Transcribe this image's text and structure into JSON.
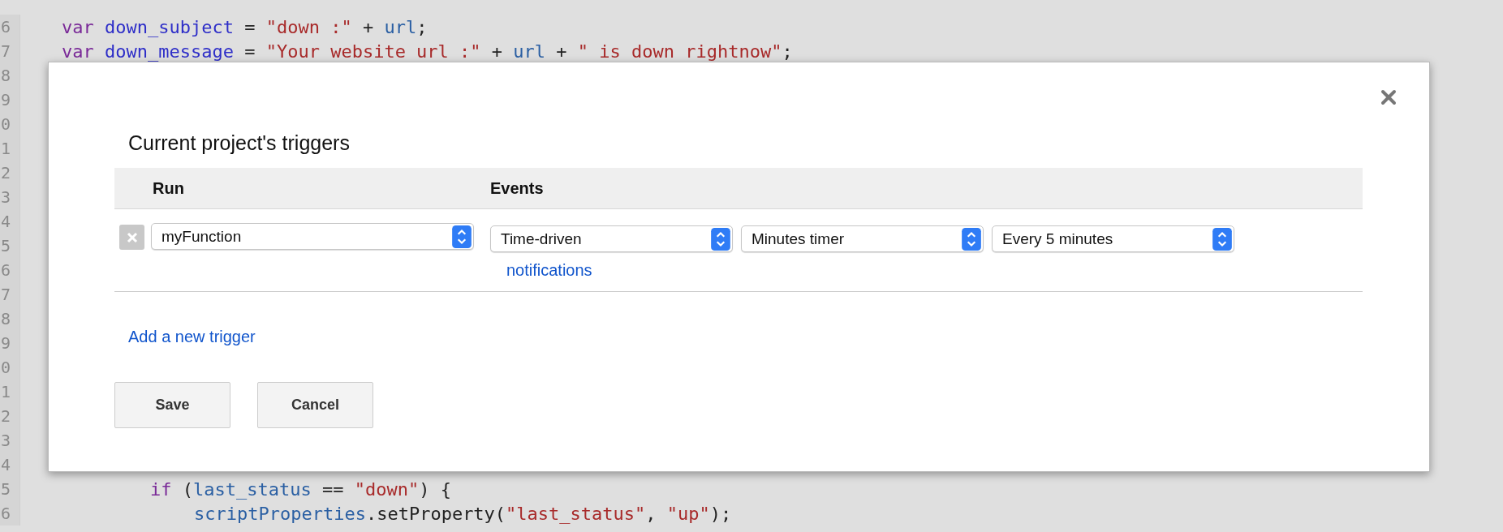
{
  "editor": {
    "lines": [
      {
        "number": "6",
        "kind": "level1",
        "tokens": [
          {
            "text": "var",
            "kind": "keyword"
          },
          {
            "text": " down_subject",
            "kind": "variable"
          },
          {
            "text": " = ",
            "kind": "plain"
          },
          {
            "text": "\"down :\"",
            "kind": "string"
          },
          {
            "text": " + ",
            "kind": "plain"
          },
          {
            "text": "url",
            "kind": "name"
          },
          {
            "text": ";",
            "kind": "plain"
          }
        ]
      },
      {
        "number": "7",
        "kind": "level1",
        "tokens": [
          {
            "text": "var",
            "kind": "keyword"
          },
          {
            "text": " down_message",
            "kind": "variable"
          },
          {
            "text": " = ",
            "kind": "plain"
          },
          {
            "text": "\"Your website url :\"",
            "kind": "string"
          },
          {
            "text": " + ",
            "kind": "plain"
          },
          {
            "text": "url",
            "kind": "name"
          },
          {
            "text": " + ",
            "kind": "plain"
          },
          {
            "text": "\" is down rightnow\"",
            "kind": "string"
          },
          {
            "text": ";",
            "kind": "plain"
          }
        ]
      },
      {
        "number": "8"
      },
      {
        "number": "9"
      },
      {
        "number": "0"
      },
      {
        "number": "1"
      },
      {
        "number": "2"
      },
      {
        "number": "3"
      },
      {
        "number": "4"
      },
      {
        "number": "5"
      },
      {
        "number": "6"
      },
      {
        "number": "7"
      },
      {
        "number": "8"
      },
      {
        "number": "9"
      },
      {
        "number": "0"
      },
      {
        "number": "1"
      },
      {
        "number": "2"
      },
      {
        "number": "3"
      },
      {
        "number": "4"
      },
      {
        "number": "5",
        "kind": "level3",
        "tokens": [
          {
            "text": "if",
            "kind": "keyword"
          },
          {
            "text": " (",
            "kind": "plain"
          },
          {
            "text": "last_status",
            "kind": "name"
          },
          {
            "text": " == ",
            "kind": "plain"
          },
          {
            "text": "\"down\"",
            "kind": "string"
          },
          {
            "text": ") {",
            "kind": "plain"
          }
        ]
      },
      {
        "number": "6",
        "kind": "level4",
        "tokens": [
          {
            "text": "scriptProperties",
            "kind": "name"
          },
          {
            "text": ".setProperty(",
            "kind": "plain"
          },
          {
            "text": "\"last_status\"",
            "kind": "string"
          },
          {
            "text": ", ",
            "kind": "plain"
          },
          {
            "text": "\"up\"",
            "kind": "string"
          },
          {
            "text": ");",
            "kind": "plain"
          }
        ]
      }
    ]
  },
  "dialog": {
    "title": "Current project's triggers",
    "columns": [
      "Run",
      "Events"
    ],
    "triggers": [
      {
        "run": "myFunction",
        "events": [
          "Time-driven",
          "Minutes timer",
          "Every 5 minutes"
        ],
        "link": "notifications"
      }
    ],
    "add_link": "Add a new trigger",
    "buttons": [
      "Save",
      "Cancel"
    ]
  }
}
